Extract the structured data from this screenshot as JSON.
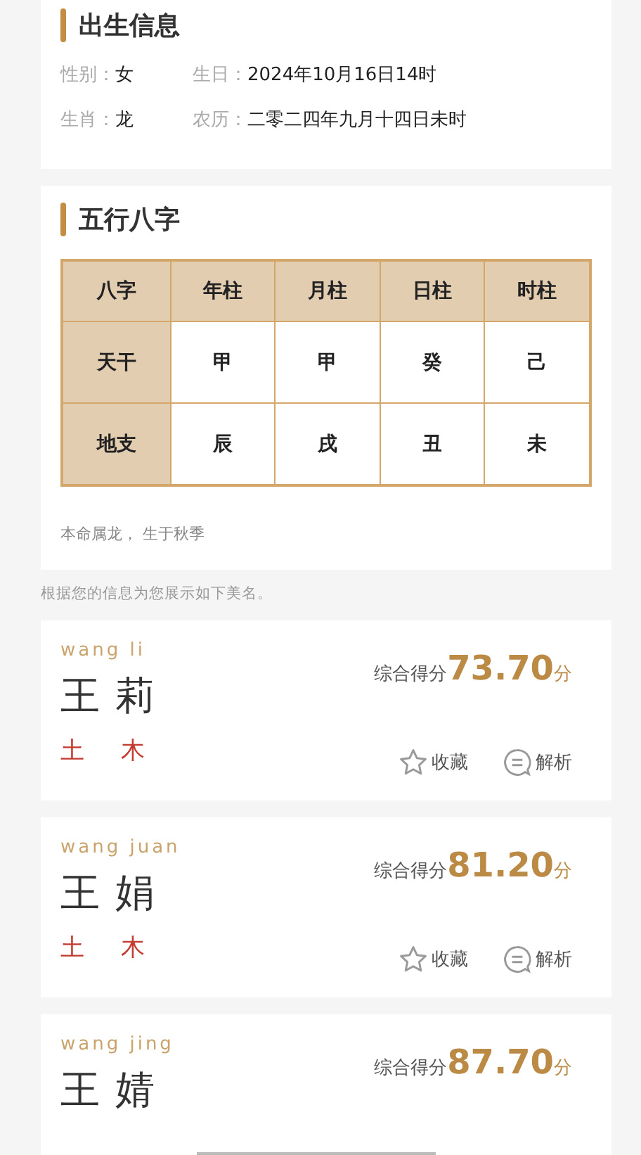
{
  "birth_info": {
    "title": "出生信息",
    "fields": [
      {
        "label": "性别：",
        "value": "女"
      },
      {
        "label": "生日：",
        "value": "2024年10月16日14时"
      },
      {
        "label": "生肖：",
        "value": "龙"
      },
      {
        "label": "农历：",
        "value": "二零二四年九月十四日未时"
      }
    ]
  },
  "bazi": {
    "title": "五行八字",
    "table": {
      "columns": [
        "八字",
        "年柱",
        "月柱",
        "日柱",
        "时柱"
      ],
      "rows": [
        [
          "天干",
          "甲",
          "甲",
          "癸",
          "己"
        ],
        [
          "地支",
          "辰",
          "戌",
          "丑",
          "未"
        ]
      ]
    },
    "note": "本命属龙， 生于秋季"
  },
  "intro": "根据您的信息为您展示如下美名。",
  "names": [
    {
      "pinyin": "wang li",
      "name": "王 莉",
      "score_label": "综合得分",
      "score": "73.70",
      "unit": "分",
      "elements": [
        "土",
        "木"
      ],
      "actions": [
        {
          "kind": "star",
          "label": "收藏"
        },
        {
          "kind": "chat",
          "label": "解析"
        }
      ]
    },
    {
      "pinyin": "wang juan",
      "name": "王 娟",
      "score_label": "综合得分",
      "score": "81.20",
      "unit": "分",
      "elements": [
        "土",
        "木"
      ],
      "actions": [
        {
          "kind": "star",
          "label": "收藏"
        },
        {
          "kind": "chat",
          "label": "解析"
        }
      ]
    },
    {
      "pinyin": "wang jing",
      "name": "王 婧",
      "score_label": "综合得分",
      "score": "87.70",
      "unit": "分"
    }
  ]
}
